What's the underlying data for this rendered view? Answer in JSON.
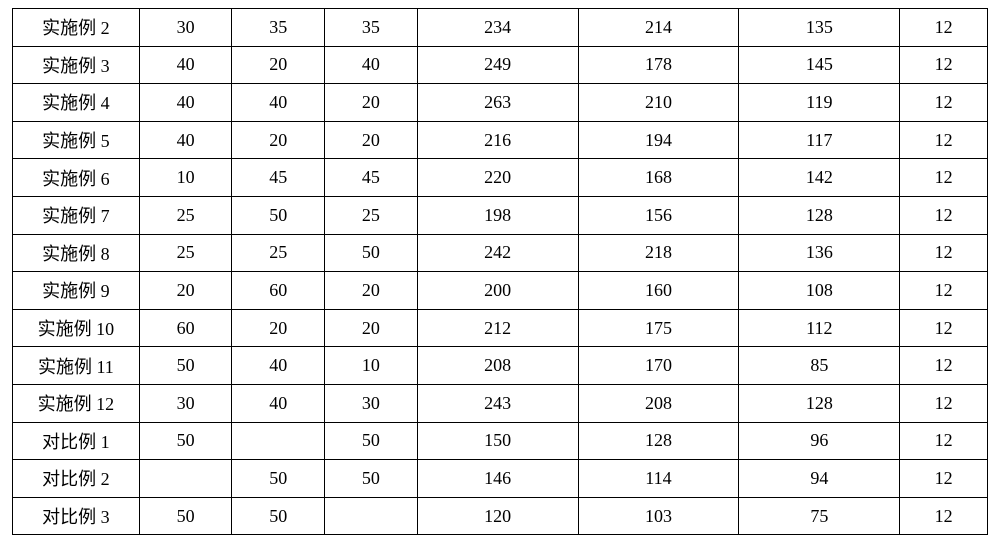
{
  "chart_data": {
    "type": "table",
    "rows": [
      {
        "label": "实施例 2",
        "cells": [
          "30",
          "35",
          "35",
          "234",
          "214",
          "135",
          "12"
        ]
      },
      {
        "label": "实施例 3",
        "cells": [
          "40",
          "20",
          "40",
          "249",
          "178",
          "145",
          "12"
        ]
      },
      {
        "label": "实施例 4",
        "cells": [
          "40",
          "40",
          "20",
          "263",
          "210",
          "119",
          "12"
        ]
      },
      {
        "label": "实施例 5",
        "cells": [
          "40",
          "20",
          "20",
          "216",
          "194",
          "117",
          "12"
        ]
      },
      {
        "label": "实施例 6",
        "cells": [
          "10",
          "45",
          "45",
          "220",
          "168",
          "142",
          "12"
        ]
      },
      {
        "label": "实施例 7",
        "cells": [
          "25",
          "50",
          "25",
          "198",
          "156",
          "128",
          "12"
        ]
      },
      {
        "label": "实施例 8",
        "cells": [
          "25",
          "25",
          "50",
          "242",
          "218",
          "136",
          "12"
        ]
      },
      {
        "label": "实施例 9",
        "cells": [
          "20",
          "60",
          "20",
          "200",
          "160",
          "108",
          "12"
        ]
      },
      {
        "label": "实施例 10",
        "cells": [
          "60",
          "20",
          "20",
          "212",
          "175",
          "112",
          "12"
        ]
      },
      {
        "label": "实施例 11",
        "cells": [
          "50",
          "40",
          "10",
          "208",
          "170",
          "85",
          "12"
        ]
      },
      {
        "label": "实施例 12",
        "cells": [
          "30",
          "40",
          "30",
          "243",
          "208",
          "128",
          "12"
        ]
      },
      {
        "label": "对比例 1",
        "cells": [
          "50",
          "",
          "50",
          "150",
          "128",
          "96",
          "12"
        ]
      },
      {
        "label": "对比例 2",
        "cells": [
          "",
          "50",
          "50",
          "146",
          "114",
          "94",
          "12"
        ]
      },
      {
        "label": "对比例 3",
        "cells": [
          "50",
          "50",
          "",
          "120",
          "103",
          "75",
          "12"
        ]
      }
    ]
  }
}
